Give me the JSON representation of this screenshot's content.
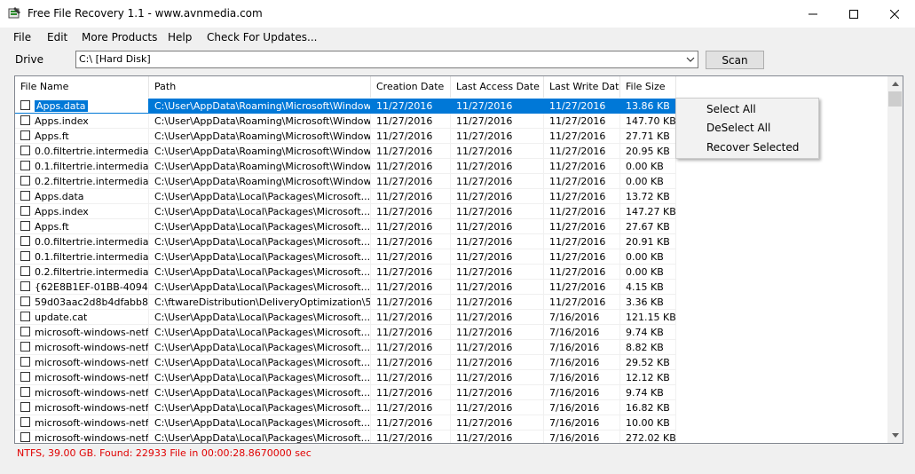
{
  "window": {
    "title": "Free File Recovery 1.1  - www.avnmedia.com"
  },
  "menu": [
    "File",
    "Edit",
    "More Products",
    "Help",
    "Check For Updates..."
  ],
  "drive": {
    "label": "Drive",
    "value": "C:\\ [Hard Disk]"
  },
  "scan_label": "Scan",
  "columns": [
    "File Name",
    "Path",
    "Creation Date",
    "Last Access Date",
    "Last Write Date",
    "File Size"
  ],
  "rows": [
    [
      "Apps.data",
      "C:\\User\\AppData\\Roaming\\Microsoft\\Windows...",
      "11/27/2016",
      "11/27/2016",
      "11/27/2016",
      "13.86 KB"
    ],
    [
      "Apps.index",
      "C:\\User\\AppData\\Roaming\\Microsoft\\Windows...",
      "11/27/2016",
      "11/27/2016",
      "11/27/2016",
      "147.70 KB"
    ],
    [
      "Apps.ft",
      "C:\\User\\AppData\\Roaming\\Microsoft\\Windows...",
      "11/27/2016",
      "11/27/2016",
      "11/27/2016",
      "27.71 KB"
    ],
    [
      "0.0.filtertrie.intermediate.txt",
      "C:\\User\\AppData\\Roaming\\Microsoft\\Windows...",
      "11/27/2016",
      "11/27/2016",
      "11/27/2016",
      "20.95 KB"
    ],
    [
      "0.1.filtertrie.intermediate.txt",
      "C:\\User\\AppData\\Roaming\\Microsoft\\Windows...",
      "11/27/2016",
      "11/27/2016",
      "11/27/2016",
      "0.00 KB"
    ],
    [
      "0.2.filtertrie.intermediate.txt",
      "C:\\User\\AppData\\Roaming\\Microsoft\\Windows...",
      "11/27/2016",
      "11/27/2016",
      "11/27/2016",
      "0.00 KB"
    ],
    [
      "Apps.data",
      "C:\\User\\AppData\\Local\\Packages\\Microsoft....",
      "11/27/2016",
      "11/27/2016",
      "11/27/2016",
      "13.72 KB"
    ],
    [
      "Apps.index",
      "C:\\User\\AppData\\Local\\Packages\\Microsoft....",
      "11/27/2016",
      "11/27/2016",
      "11/27/2016",
      "147.27 KB"
    ],
    [
      "Apps.ft",
      "C:\\User\\AppData\\Local\\Packages\\Microsoft....",
      "11/27/2016",
      "11/27/2016",
      "11/27/2016",
      "27.67 KB"
    ],
    [
      "0.0.filtertrie.intermediate.txt",
      "C:\\User\\AppData\\Local\\Packages\\Microsoft....",
      "11/27/2016",
      "11/27/2016",
      "11/27/2016",
      "20.91 KB"
    ],
    [
      "0.1.filtertrie.intermediate.txt",
      "C:\\User\\AppData\\Local\\Packages\\Microsoft....",
      "11/27/2016",
      "11/27/2016",
      "11/27/2016",
      "0.00 KB"
    ],
    [
      "0.2.filtertrie.intermediate.txt",
      "C:\\User\\AppData\\Local\\Packages\\Microsoft....",
      "11/27/2016",
      "11/27/2016",
      "11/27/2016",
      "0.00 KB"
    ],
    [
      "{62E8B1EF-01BB-4094-...",
      "C:\\User\\AppData\\Local\\Packages\\Microsoft....",
      "11/27/2016",
      "11/27/2016",
      "11/27/2016",
      "4.15 KB"
    ],
    [
      "59d03aac2d8b4dfabb83...",
      "C:\\ftwareDistribution\\DeliveryOptimization\\59d0...",
      "11/27/2016",
      "11/27/2016",
      "11/27/2016",
      "3.36 KB"
    ],
    [
      "update.cat",
      "C:\\User\\AppData\\Local\\Packages\\Microsoft....",
      "11/27/2016",
      "11/27/2016",
      "7/16/2016",
      "121.15 KB"
    ],
    [
      "microsoft-windows-netfx-...",
      "C:\\User\\AppData\\Local\\Packages\\Microsoft....",
      "11/27/2016",
      "11/27/2016",
      "7/16/2016",
      "9.74 KB"
    ],
    [
      "microsoft-windows-netfx-...",
      "C:\\User\\AppData\\Local\\Packages\\Microsoft....",
      "11/27/2016",
      "11/27/2016",
      "7/16/2016",
      "8.82 KB"
    ],
    [
      "microsoft-windows-netfx-...",
      "C:\\User\\AppData\\Local\\Packages\\Microsoft....",
      "11/27/2016",
      "11/27/2016",
      "7/16/2016",
      "29.52 KB"
    ],
    [
      "microsoft-windows-netfx-...",
      "C:\\User\\AppData\\Local\\Packages\\Microsoft....",
      "11/27/2016",
      "11/27/2016",
      "7/16/2016",
      "12.12 KB"
    ],
    [
      "microsoft-windows-netfx-...",
      "C:\\User\\AppData\\Local\\Packages\\Microsoft....",
      "11/27/2016",
      "11/27/2016",
      "7/16/2016",
      "9.74 KB"
    ],
    [
      "microsoft-windows-netfx-...",
      "C:\\User\\AppData\\Local\\Packages\\Microsoft....",
      "11/27/2016",
      "11/27/2016",
      "7/16/2016",
      "16.82 KB"
    ],
    [
      "microsoft-windows-netfx-...",
      "C:\\User\\AppData\\Local\\Packages\\Microsoft....",
      "11/27/2016",
      "11/27/2016",
      "7/16/2016",
      "10.00 KB"
    ],
    [
      "microsoft-windows-netfx-...",
      "C:\\User\\AppData\\Local\\Packages\\Microsoft....",
      "11/27/2016",
      "11/27/2016",
      "7/16/2016",
      "272.02 KB"
    ]
  ],
  "context_menu": [
    "Select All",
    "DeSelect All",
    "Recover Selected"
  ],
  "status": "NTFS, 39.00 GB. Found: 22933 File in 00:00:28.8670000 sec",
  "colors": {
    "selection": "#0078d7",
    "status_text": "#e00000"
  }
}
